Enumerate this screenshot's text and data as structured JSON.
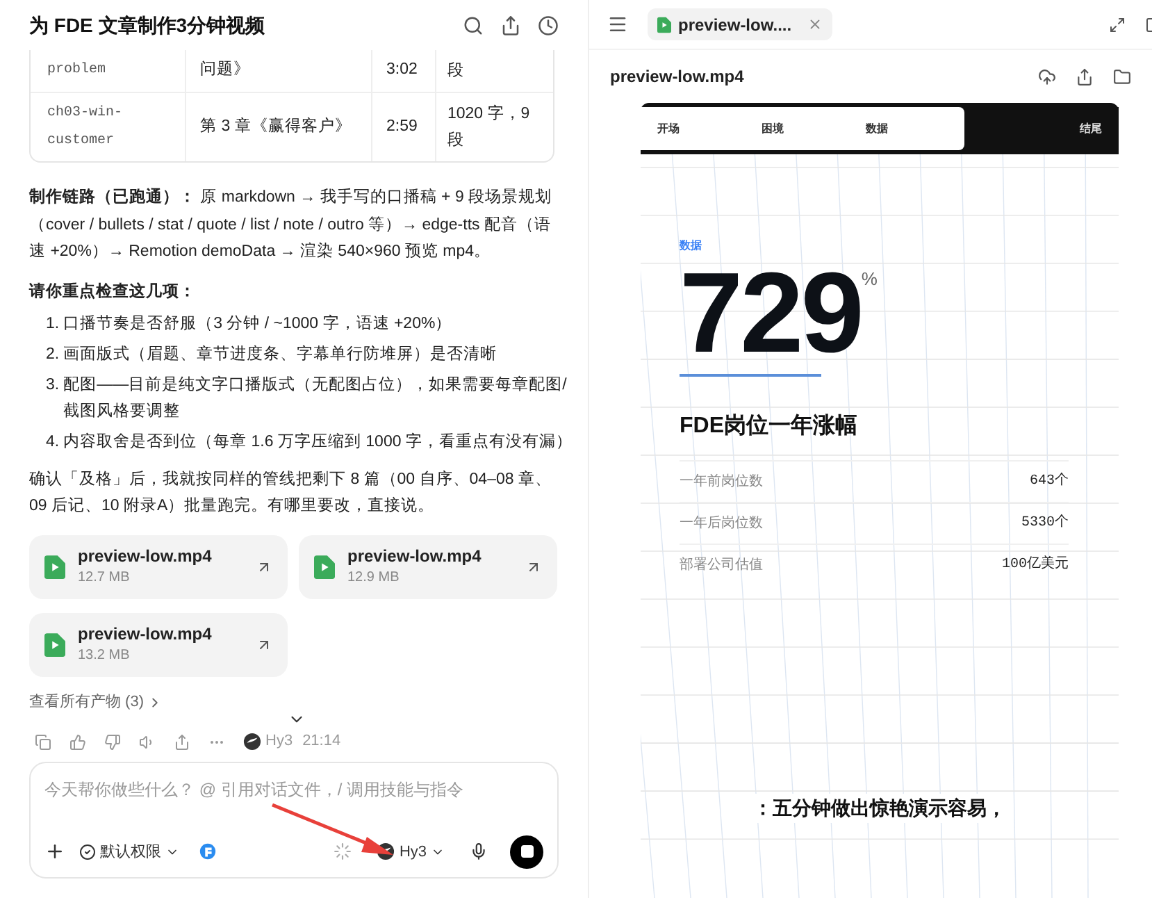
{
  "chat": {
    "title": "为 FDE 文章制作3分钟视频",
    "table": {
      "rows": [
        {
          "code": "problem",
          "chapter": "问题》",
          "duration": "3:02",
          "size": "段"
        },
        {
          "code": "ch03-win-customer",
          "chapter": "第 3 章《赢得客户》",
          "duration": "2:59",
          "size": "1020 字，9 段"
        }
      ]
    },
    "pipeline": {
      "label": "制作链路（已跑通）：",
      "text": "原 markdown → 我手写的口播稿 + 9 段场景规划（cover / bullets / stat / quote / list / note / outro 等）→ edge-tts 配音（语速 +20%）→ Remotion demoData → 渲染 540×960 预览 mp4。"
    },
    "check_heading": "请你重点检查这几项：",
    "checks": [
      {
        "number": "1.",
        "text": "口播节奏是否舒服（3 分钟 / ~1000 字，语速 +20%）"
      },
      {
        "number": "2.",
        "text": "画面版式（眉题、章节进度条、字幕单行防堆屏）是否清晰"
      },
      {
        "number": "3.",
        "text": "配图——目前是纯文字口播版式（无配图占位），如果需要每章配图/截图风格要调整"
      },
      {
        "number": "4.",
        "text": "内容取舍是否到位（每章 1.6 万字压缩到 1000 字，看重点有没有漏）"
      }
    ],
    "closing": "确认「及格」后，我就按同样的管线把剩下 8 篇（00 自序、04–08 章、09 后记、10 附录A）批量跑完。有哪里要改，直接说。",
    "files": [
      {
        "name": "preview-low.mp4",
        "size": "12.7 MB"
      },
      {
        "name": "preview-low.mp4",
        "size": "12.9 MB"
      },
      {
        "name": "preview-low.mp4",
        "size": "13.2 MB"
      }
    ],
    "all_artifacts": "查看所有产物 (3)",
    "model": "Hy3",
    "time": "21:14",
    "composer": {
      "placeholder": "今天帮你做些什么？ @ 引用对话文件，/ 调用技能与指令",
      "permission": "默认权限",
      "model": "Hy3"
    }
  },
  "preview": {
    "tab": "preview-low....",
    "file_title": "preview-low.mp4",
    "video": {
      "chapters": [
        {
          "label": "开场",
          "done": true
        },
        {
          "label": "困境",
          "done": true
        },
        {
          "label": "数据",
          "done": true
        },
        {
          "label": "结尾",
          "done": false
        }
      ],
      "eyebrow": "数据",
      "stat": "729",
      "unit": "%",
      "stat_title": "FDE岗位一年涨幅",
      "rows": [
        {
          "label": "一年前岗位数",
          "value": "643个"
        },
        {
          "label": "一年后岗位数",
          "value": "5330个"
        },
        {
          "label": "部署公司估值",
          "value": "100亿美元"
        }
      ],
      "caption": "：五分钟做出惊艳演示容易，"
    }
  }
}
